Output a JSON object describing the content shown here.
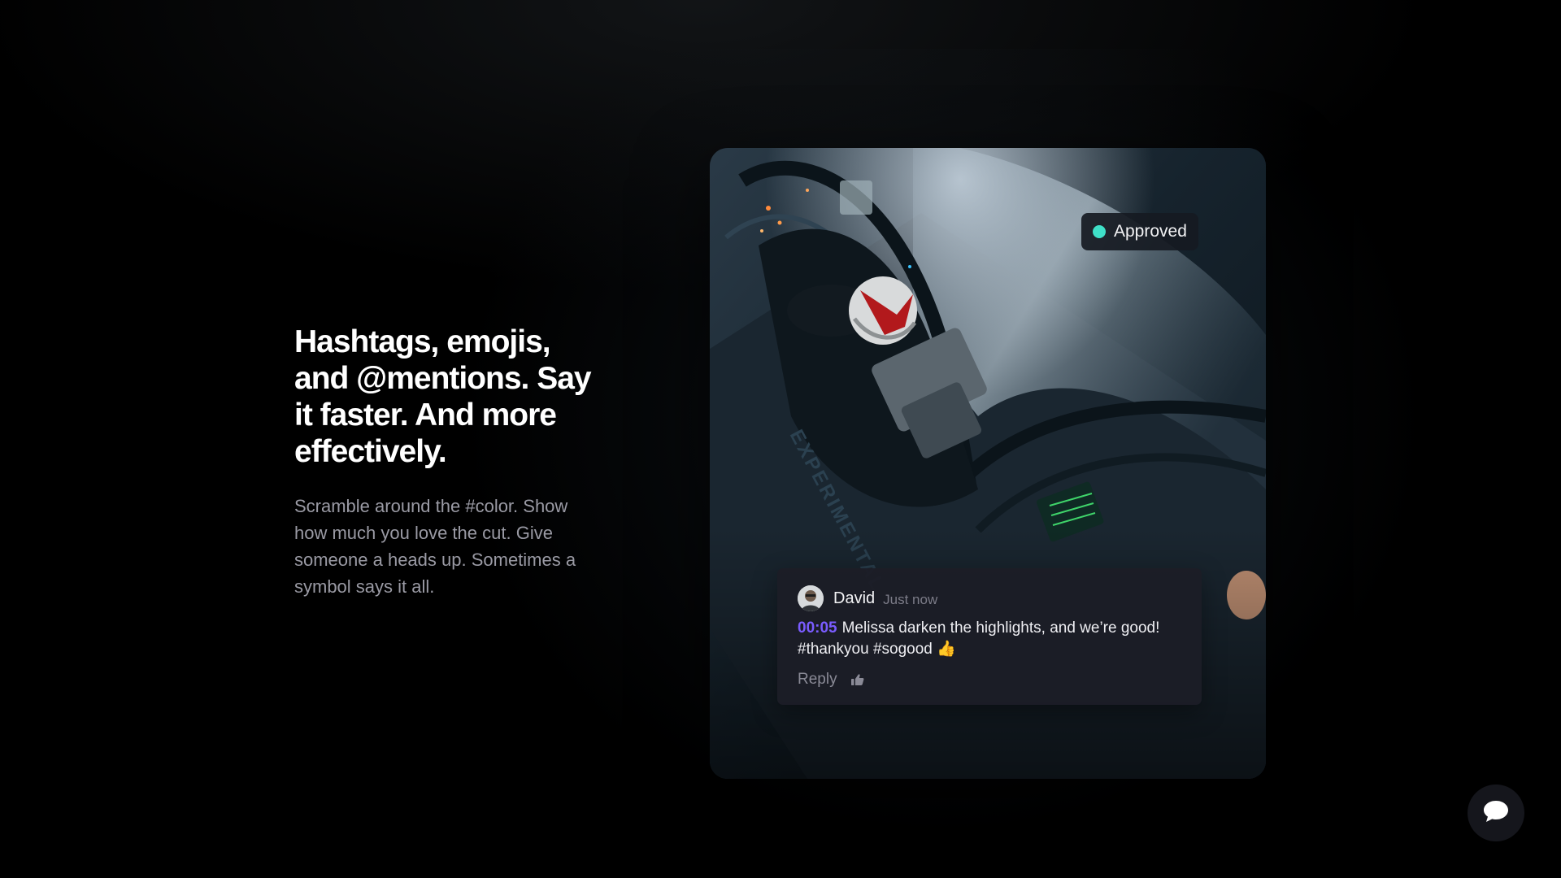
{
  "feature": {
    "headline": "Hashtags, emojis, and @mentions. Say it faster. And more effectively.",
    "body": "Scramble around the #color. Show how much you love the cut. Give someone a heads up. Sometimes a symbol says it all."
  },
  "media": {
    "status": {
      "label": "Approved",
      "color": "#3fe0c8"
    },
    "comment": {
      "author": "David",
      "time": "Just now",
      "timecode": "00:05",
      "text": "Melissa darken the highlights, and we’re good! #thankyou #sogood",
      "emoji": "👍",
      "reply_label": "Reply",
      "like_icon": "thumbs-up-icon"
    }
  },
  "chat_widget": {
    "icon": "chat-bubble-icon"
  },
  "colors": {
    "background": "#000000",
    "accent_timecode": "#7a5cff",
    "status_approved": "#3fe0c8"
  }
}
